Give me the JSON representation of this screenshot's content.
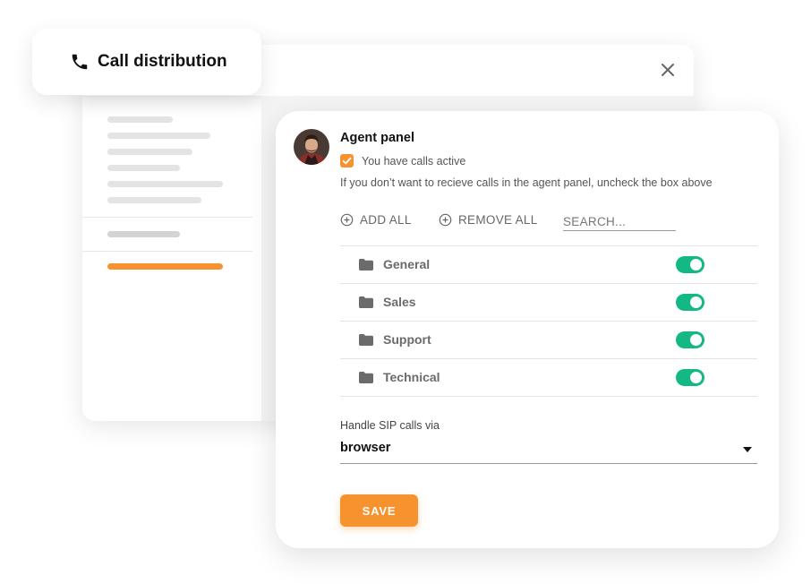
{
  "window": {
    "title": "Call distribution"
  },
  "agent_panel": {
    "title": "Agent panel",
    "checkbox_label": "You have calls active",
    "checkbox_checked": true,
    "hint": "If you don’t want to recieve calls in the agent panel, uncheck the box above"
  },
  "actions": {
    "add_all": "ADD ALL",
    "remove_all": "REMOVE ALL",
    "search_placeholder": "SEARCH..."
  },
  "queues": [
    {
      "name": "General",
      "enabled": true
    },
    {
      "name": "Sales",
      "enabled": true
    },
    {
      "name": "Support",
      "enabled": true
    },
    {
      "name": "Technical",
      "enabled": true
    }
  ],
  "sip": {
    "label": "Handle SIP calls via",
    "value": "browser"
  },
  "save_label": "SAVE",
  "colors": {
    "accent": "#f7932f",
    "toggle_on": "#14b885"
  },
  "icons": {
    "title": "phone-icon",
    "close": "close-icon",
    "add": "plus-circle-icon",
    "folder": "folder-icon",
    "dropdown": "caret-down-icon"
  }
}
